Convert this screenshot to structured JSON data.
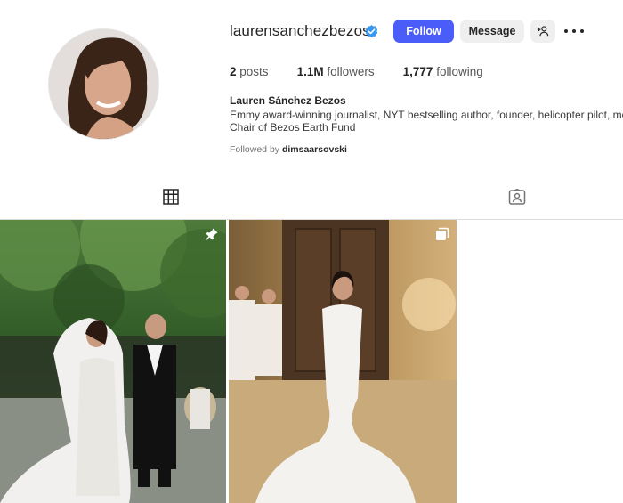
{
  "profile": {
    "username": "laurensanchezbezos",
    "verified_icon": "verified-badge-icon",
    "full_name": "Lauren Sánchez Bezos",
    "bio_line1": "Emmy award-winning journalist, NYT bestselling author, founder, helicopter pilot, mom",
    "bio_line2": "Chair of Bezos Earth Fund",
    "followed_by_label": "Followed by",
    "followed_by_user": "dimsaarsovski"
  },
  "actions": {
    "follow_label": "Follow",
    "message_label": "Message",
    "add_user_icon": "add-user-icon",
    "more_icon": "more-options-icon"
  },
  "stats": {
    "posts_count": "2",
    "posts_label": "posts",
    "followers_count": "1.1M",
    "followers_label": "followers",
    "following_count": "1,777",
    "following_label": "following"
  },
  "tabs": [
    {
      "name": "posts",
      "icon": "grid-icon",
      "active": true
    },
    {
      "name": "tagged",
      "icon": "tagged-user-icon",
      "active": false
    }
  ],
  "posts": [
    {
      "icon": "pin-icon"
    },
    {
      "icon": "carousel-icon"
    }
  ],
  "colors": {
    "follow_button": "#4a5df9",
    "secondary_button": "#efefef",
    "verified": "#3897f0",
    "text": "#262626",
    "muted": "#737373"
  }
}
